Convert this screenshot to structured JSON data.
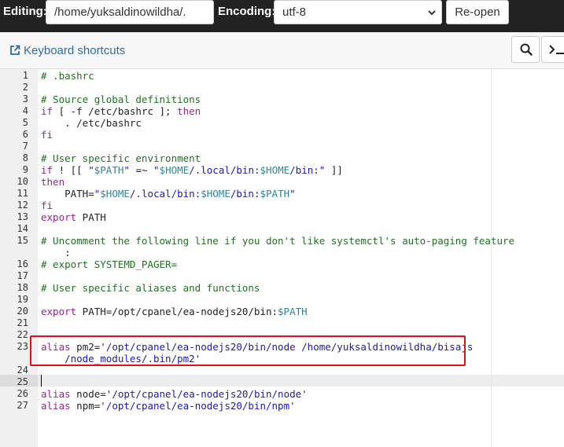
{
  "toolbar": {
    "editing_label": "Editing:",
    "file_path": "/home/yuksaldinowildha/.",
    "encoding_label": "Encoding:",
    "encoding_value": "utf-8",
    "reopen_label": "Re-open"
  },
  "subheader": {
    "keyboard_shortcuts": "Keyboard shortcuts"
  },
  "editor": {
    "active_line": 25,
    "highlighted_line": 23,
    "lines": [
      {
        "n": "1",
        "t": "# .bashrc"
      },
      {
        "n": "2",
        "t": ""
      },
      {
        "n": "3",
        "t": "# Source global definitions"
      },
      {
        "n": "4",
        "t": "if [ -f /etc/bashrc ]; then"
      },
      {
        "n": "5",
        "t": "    . /etc/bashrc"
      },
      {
        "n": "6",
        "t": "fi"
      },
      {
        "n": "7",
        "t": ""
      },
      {
        "n": "8",
        "t": "# User specific environment"
      },
      {
        "n": "9",
        "t": "if ! [[ \"$PATH\" =~ \"$HOME/.local/bin:$HOME/bin:\" ]]"
      },
      {
        "n": "10",
        "t": "then"
      },
      {
        "n": "11",
        "t": "    PATH=\"$HOME/.local/bin:$HOME/bin:$PATH\""
      },
      {
        "n": "12",
        "t": "fi"
      },
      {
        "n": "13",
        "t": "export PATH"
      },
      {
        "n": "14",
        "t": ""
      },
      {
        "n": "15",
        "t": "# Uncomment the following line if you don't like systemctl's auto-paging feature"
      },
      {
        "n": "",
        "t": "    :"
      },
      {
        "n": "16",
        "t": "# export SYSTEMD_PAGER="
      },
      {
        "n": "17",
        "t": ""
      },
      {
        "n": "18",
        "t": "# User specific aliases and functions"
      },
      {
        "n": "19",
        "t": ""
      },
      {
        "n": "20",
        "t": "export PATH=/opt/cpanel/ea-nodejs20/bin:$PATH"
      },
      {
        "n": "21",
        "t": ""
      },
      {
        "n": "22",
        "t": ""
      },
      {
        "n": "23",
        "t": "alias pm2='/opt/cpanel/ea-nodejs20/bin/node /home/yuksaldinowildha/bisajs"
      },
      {
        "n": "",
        "t": "    /node_modules/.bin/pm2'"
      },
      {
        "n": "24",
        "t": ""
      },
      {
        "n": "25",
        "t": ""
      },
      {
        "n": "26",
        "t": "alias node='/opt/cpanel/ea-nodejs20/bin/node'"
      },
      {
        "n": "27",
        "t": "alias npm='/opt/cpanel/ea-nodejs20/bin/npm'"
      }
    ]
  },
  "colors": {
    "toolbar_bg": "#222222",
    "link": "#2d6ca2",
    "highlight_border": "#e0101a",
    "comment": "#236e24",
    "keyword": "#93278f",
    "string": "#1a1aa6"
  },
  "icons": {
    "search": "search-icon",
    "terminal": "terminal-icon",
    "external_link": "external-link-icon",
    "dropdown": "chevron-down-icon"
  }
}
